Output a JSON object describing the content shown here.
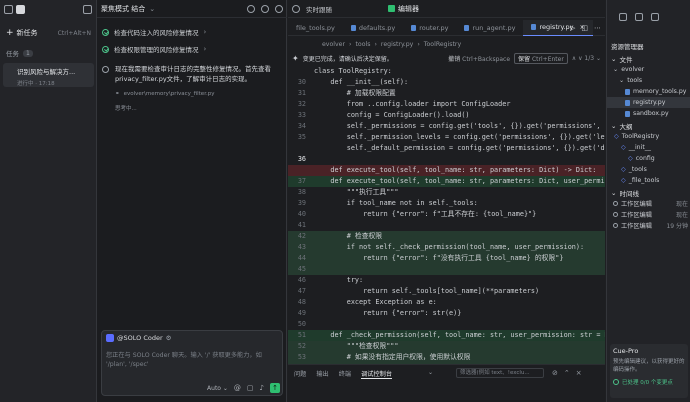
{
  "app": {
    "colors": {
      "accent_green": "#2fbf71",
      "bg": "#1e1f22",
      "del_bg": "#4a2226",
      "add_bg": "#1f3b2c"
    }
  },
  "left": {
    "new_task": "新任务",
    "new_task_shortcut": "Ctrl+Alt+N",
    "tasks_label": "任务",
    "tasks_count": "1",
    "task": {
      "title": "识别风险与解决方...",
      "status": "进行中 · 17:18"
    }
  },
  "chat": {
    "title": "聚焦模式 结合",
    "checks": [
      "检查代码注入的风险修复情况",
      "检查权限管理的风险修复情况"
    ],
    "message": "现在我需要检查审计日志的完整性修复情况。首先查看privacy_filter.py文件，了解审计日志的实现。",
    "file_ref": "evolver\\memory\\privacy_filter.py",
    "thinking": "思考中...",
    "mention": "@SOLO Coder",
    "placeholder": "您正在与 SOLO Coder 聊天。输入 '/' 获取更多能力，如 '/plan', '/spec'",
    "mode": "Auto"
  },
  "editor": {
    "top_left": "实时跟随",
    "top_center": "编辑器",
    "tabs": [
      "file_tools.py",
      "defaults.py",
      "router.py",
      "run_agent.py",
      "registry.py"
    ],
    "active_tab": 4,
    "breadcrumb": [
      "evolver",
      "tools",
      "registry.py",
      "ToolRegistry"
    ],
    "changes_msg": "变更已完成，请确认后决定保留。",
    "undo_label": "撤销",
    "undo_key": "Ctrl+Backspace",
    "keep_label": "保留",
    "keep_key": "Ctrl+Enter",
    "pager": "1/3",
    "lines": [
      {
        "n": "",
        "t": "class ToolRegistry:",
        "k": ""
      },
      {
        "n": "30",
        "t": "    def __init__(self):",
        "k": ""
      },
      {
        "n": "31",
        "t": "        # 加载权限配置",
        "k": ""
      },
      {
        "n": "32",
        "t": "        from ..config.loader import ConfigLoader",
        "k": ""
      },
      {
        "n": "33",
        "t": "        config = ConfigLoader().load()",
        "k": ""
      },
      {
        "n": "34",
        "t": "        self._permissions = config.get('tools', {}).get('permissions', {})",
        "k": ""
      },
      {
        "n": "35",
        "t": "        self._permission_levels = config.get('permissions', {}).get('levels', {})",
        "k": ""
      },
      {
        "n": "",
        "t": "        self._default_permission = config.get('permissions', {}).get('default')",
        "k": ""
      },
      {
        "n": "36",
        "t": "",
        "k": "cur"
      },
      {
        "n": "",
        "t": "    def execute_tool(self, tool_name: str, parameters: Dict) -> Dict:",
        "k": "del"
      },
      {
        "n": "37",
        "t": "    def execute_tool(self, tool_name: str, parameters: Dict, user_permission: str",
        "k": "add"
      },
      {
        "n": "38",
        "t": "        \"\"\"执行工具\"\"\"",
        "k": ""
      },
      {
        "n": "39",
        "t": "        if tool_name not in self._tools:",
        "k": ""
      },
      {
        "n": "40",
        "t": "            return {\"error\": f\"工具不存在: {tool_name}\"}",
        "k": ""
      },
      {
        "n": "41",
        "t": "",
        "k": ""
      },
      {
        "n": "42",
        "t": "        # 检查权限",
        "k": "addlight"
      },
      {
        "n": "43",
        "t": "        if not self._check_permission(tool_name, user_permission):",
        "k": "addlight"
      },
      {
        "n": "44",
        "t": "            return {\"error\": f\"没有执行工具 {tool_name} 的权限\"}",
        "k": "addlight"
      },
      {
        "n": "45",
        "t": "",
        "k": "addlight"
      },
      {
        "n": "46",
        "t": "        try:",
        "k": ""
      },
      {
        "n": "47",
        "t": "            return self._tools[tool_name](**parameters)",
        "k": ""
      },
      {
        "n": "48",
        "t": "        except Exception as e:",
        "k": ""
      },
      {
        "n": "49",
        "t": "            return {\"error\": str(e)}",
        "k": ""
      },
      {
        "n": "50",
        "t": "",
        "k": ""
      },
      {
        "n": "51",
        "t": "    def _check_permission(self, tool_name: str, user_permission: str = None) -> bool",
        "k": "add"
      },
      {
        "n": "52",
        "t": "        \"\"\"检查权限\"\"\"",
        "k": "addlight"
      },
      {
        "n": "53",
        "t": "        # 如果没有指定用户权限，使用默认权限",
        "k": "addlight"
      },
      {
        "n": "54",
        "t": "        if not user_permission:",
        "k": "addlight"
      },
      {
        "n": "55",
        "t": "            user_permission = self._default_permission",
        "k": "addlight"
      }
    ],
    "panel_tabs": [
      "问题",
      "输出",
      "终端",
      "调试控制台"
    ],
    "active_panel": 3,
    "filter_placeholder": "筛选器(例如 text、!exclu...",
    "filter_tab_label": "筛选器"
  },
  "right": {
    "title": "资源管理器",
    "files_label": "文件",
    "tree": [
      {
        "label": "evolver",
        "indent": 1,
        "type": "folder"
      },
      {
        "label": "tools",
        "indent": 2,
        "type": "folder"
      },
      {
        "label": "memory_tools.py",
        "indent": 3,
        "type": "file"
      },
      {
        "label": "registry.py",
        "indent": 3,
        "type": "file",
        "selected": true
      },
      {
        "label": "sandbox.py",
        "indent": 3,
        "type": "file"
      }
    ],
    "outline_label": "大纲",
    "outline": [
      {
        "label": "ToolRegistry",
        "indent": 1
      },
      {
        "label": "__init__",
        "indent": 2
      },
      {
        "label": "config",
        "indent": 3
      },
      {
        "label": "_tools",
        "indent": 2
      },
      {
        "label": "_file_tools",
        "indent": 2
      }
    ],
    "timeline_label": "时间线",
    "timeline": [
      {
        "label": "工作区编辑",
        "tag": "现在"
      },
      {
        "label": "工作区编辑",
        "tag": "现在"
      },
      {
        "label": "工作区编辑",
        "tag": "19 分钟"
      }
    ],
    "coder": {
      "title": "Cue-Pro",
      "desc": "预先编辑建议，以获得更好的编码操作。",
      "progress": "已处理 0/0 个变更点"
    }
  }
}
